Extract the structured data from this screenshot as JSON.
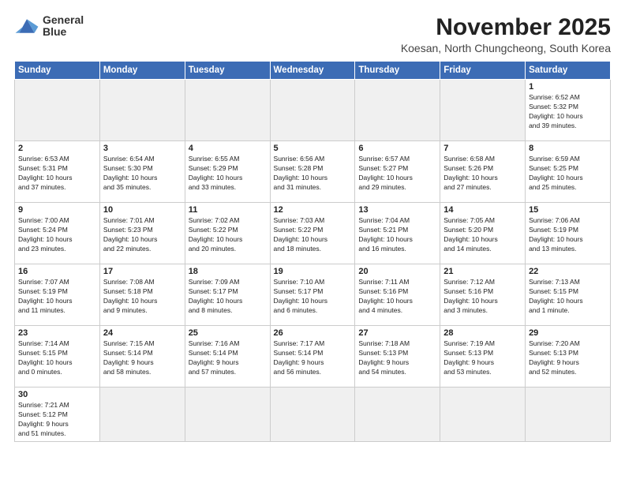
{
  "logo": {
    "line1": "General",
    "line2": "Blue"
  },
  "title": "November 2025",
  "location": "Koesan, North Chungcheong, South Korea",
  "days_of_week": [
    "Sunday",
    "Monday",
    "Tuesday",
    "Wednesday",
    "Thursday",
    "Friday",
    "Saturday"
  ],
  "weeks": [
    [
      {
        "day": "",
        "info": ""
      },
      {
        "day": "",
        "info": ""
      },
      {
        "day": "",
        "info": ""
      },
      {
        "day": "",
        "info": ""
      },
      {
        "day": "",
        "info": ""
      },
      {
        "day": "",
        "info": ""
      },
      {
        "day": "1",
        "info": "Sunrise: 6:52 AM\nSunset: 5:32 PM\nDaylight: 10 hours\nand 39 minutes."
      }
    ],
    [
      {
        "day": "2",
        "info": "Sunrise: 6:53 AM\nSunset: 5:31 PM\nDaylight: 10 hours\nand 37 minutes."
      },
      {
        "day": "3",
        "info": "Sunrise: 6:54 AM\nSunset: 5:30 PM\nDaylight: 10 hours\nand 35 minutes."
      },
      {
        "day": "4",
        "info": "Sunrise: 6:55 AM\nSunset: 5:29 PM\nDaylight: 10 hours\nand 33 minutes."
      },
      {
        "day": "5",
        "info": "Sunrise: 6:56 AM\nSunset: 5:28 PM\nDaylight: 10 hours\nand 31 minutes."
      },
      {
        "day": "6",
        "info": "Sunrise: 6:57 AM\nSunset: 5:27 PM\nDaylight: 10 hours\nand 29 minutes."
      },
      {
        "day": "7",
        "info": "Sunrise: 6:58 AM\nSunset: 5:26 PM\nDaylight: 10 hours\nand 27 minutes."
      },
      {
        "day": "8",
        "info": "Sunrise: 6:59 AM\nSunset: 5:25 PM\nDaylight: 10 hours\nand 25 minutes."
      }
    ],
    [
      {
        "day": "9",
        "info": "Sunrise: 7:00 AM\nSunset: 5:24 PM\nDaylight: 10 hours\nand 23 minutes."
      },
      {
        "day": "10",
        "info": "Sunrise: 7:01 AM\nSunset: 5:23 PM\nDaylight: 10 hours\nand 22 minutes."
      },
      {
        "day": "11",
        "info": "Sunrise: 7:02 AM\nSunset: 5:22 PM\nDaylight: 10 hours\nand 20 minutes."
      },
      {
        "day": "12",
        "info": "Sunrise: 7:03 AM\nSunset: 5:22 PM\nDaylight: 10 hours\nand 18 minutes."
      },
      {
        "day": "13",
        "info": "Sunrise: 7:04 AM\nSunset: 5:21 PM\nDaylight: 10 hours\nand 16 minutes."
      },
      {
        "day": "14",
        "info": "Sunrise: 7:05 AM\nSunset: 5:20 PM\nDaylight: 10 hours\nand 14 minutes."
      },
      {
        "day": "15",
        "info": "Sunrise: 7:06 AM\nSunset: 5:19 PM\nDaylight: 10 hours\nand 13 minutes."
      }
    ],
    [
      {
        "day": "16",
        "info": "Sunrise: 7:07 AM\nSunset: 5:19 PM\nDaylight: 10 hours\nand 11 minutes."
      },
      {
        "day": "17",
        "info": "Sunrise: 7:08 AM\nSunset: 5:18 PM\nDaylight: 10 hours\nand 9 minutes."
      },
      {
        "day": "18",
        "info": "Sunrise: 7:09 AM\nSunset: 5:17 PM\nDaylight: 10 hours\nand 8 minutes."
      },
      {
        "day": "19",
        "info": "Sunrise: 7:10 AM\nSunset: 5:17 PM\nDaylight: 10 hours\nand 6 minutes."
      },
      {
        "day": "20",
        "info": "Sunrise: 7:11 AM\nSunset: 5:16 PM\nDaylight: 10 hours\nand 4 minutes."
      },
      {
        "day": "21",
        "info": "Sunrise: 7:12 AM\nSunset: 5:16 PM\nDaylight: 10 hours\nand 3 minutes."
      },
      {
        "day": "22",
        "info": "Sunrise: 7:13 AM\nSunset: 5:15 PM\nDaylight: 10 hours\nand 1 minute."
      }
    ],
    [
      {
        "day": "23",
        "info": "Sunrise: 7:14 AM\nSunset: 5:15 PM\nDaylight: 10 hours\nand 0 minutes."
      },
      {
        "day": "24",
        "info": "Sunrise: 7:15 AM\nSunset: 5:14 PM\nDaylight: 9 hours\nand 58 minutes."
      },
      {
        "day": "25",
        "info": "Sunrise: 7:16 AM\nSunset: 5:14 PM\nDaylight: 9 hours\nand 57 minutes."
      },
      {
        "day": "26",
        "info": "Sunrise: 7:17 AM\nSunset: 5:14 PM\nDaylight: 9 hours\nand 56 minutes."
      },
      {
        "day": "27",
        "info": "Sunrise: 7:18 AM\nSunset: 5:13 PM\nDaylight: 9 hours\nand 54 minutes."
      },
      {
        "day": "28",
        "info": "Sunrise: 7:19 AM\nSunset: 5:13 PM\nDaylight: 9 hours\nand 53 minutes."
      },
      {
        "day": "29",
        "info": "Sunrise: 7:20 AM\nSunset: 5:13 PM\nDaylight: 9 hours\nand 52 minutes."
      }
    ],
    [
      {
        "day": "30",
        "info": "Sunrise: 7:21 AM\nSunset: 5:12 PM\nDaylight: 9 hours\nand 51 minutes."
      },
      {
        "day": "",
        "info": ""
      },
      {
        "day": "",
        "info": ""
      },
      {
        "day": "",
        "info": ""
      },
      {
        "day": "",
        "info": ""
      },
      {
        "day": "",
        "info": ""
      },
      {
        "day": "",
        "info": ""
      }
    ]
  ]
}
